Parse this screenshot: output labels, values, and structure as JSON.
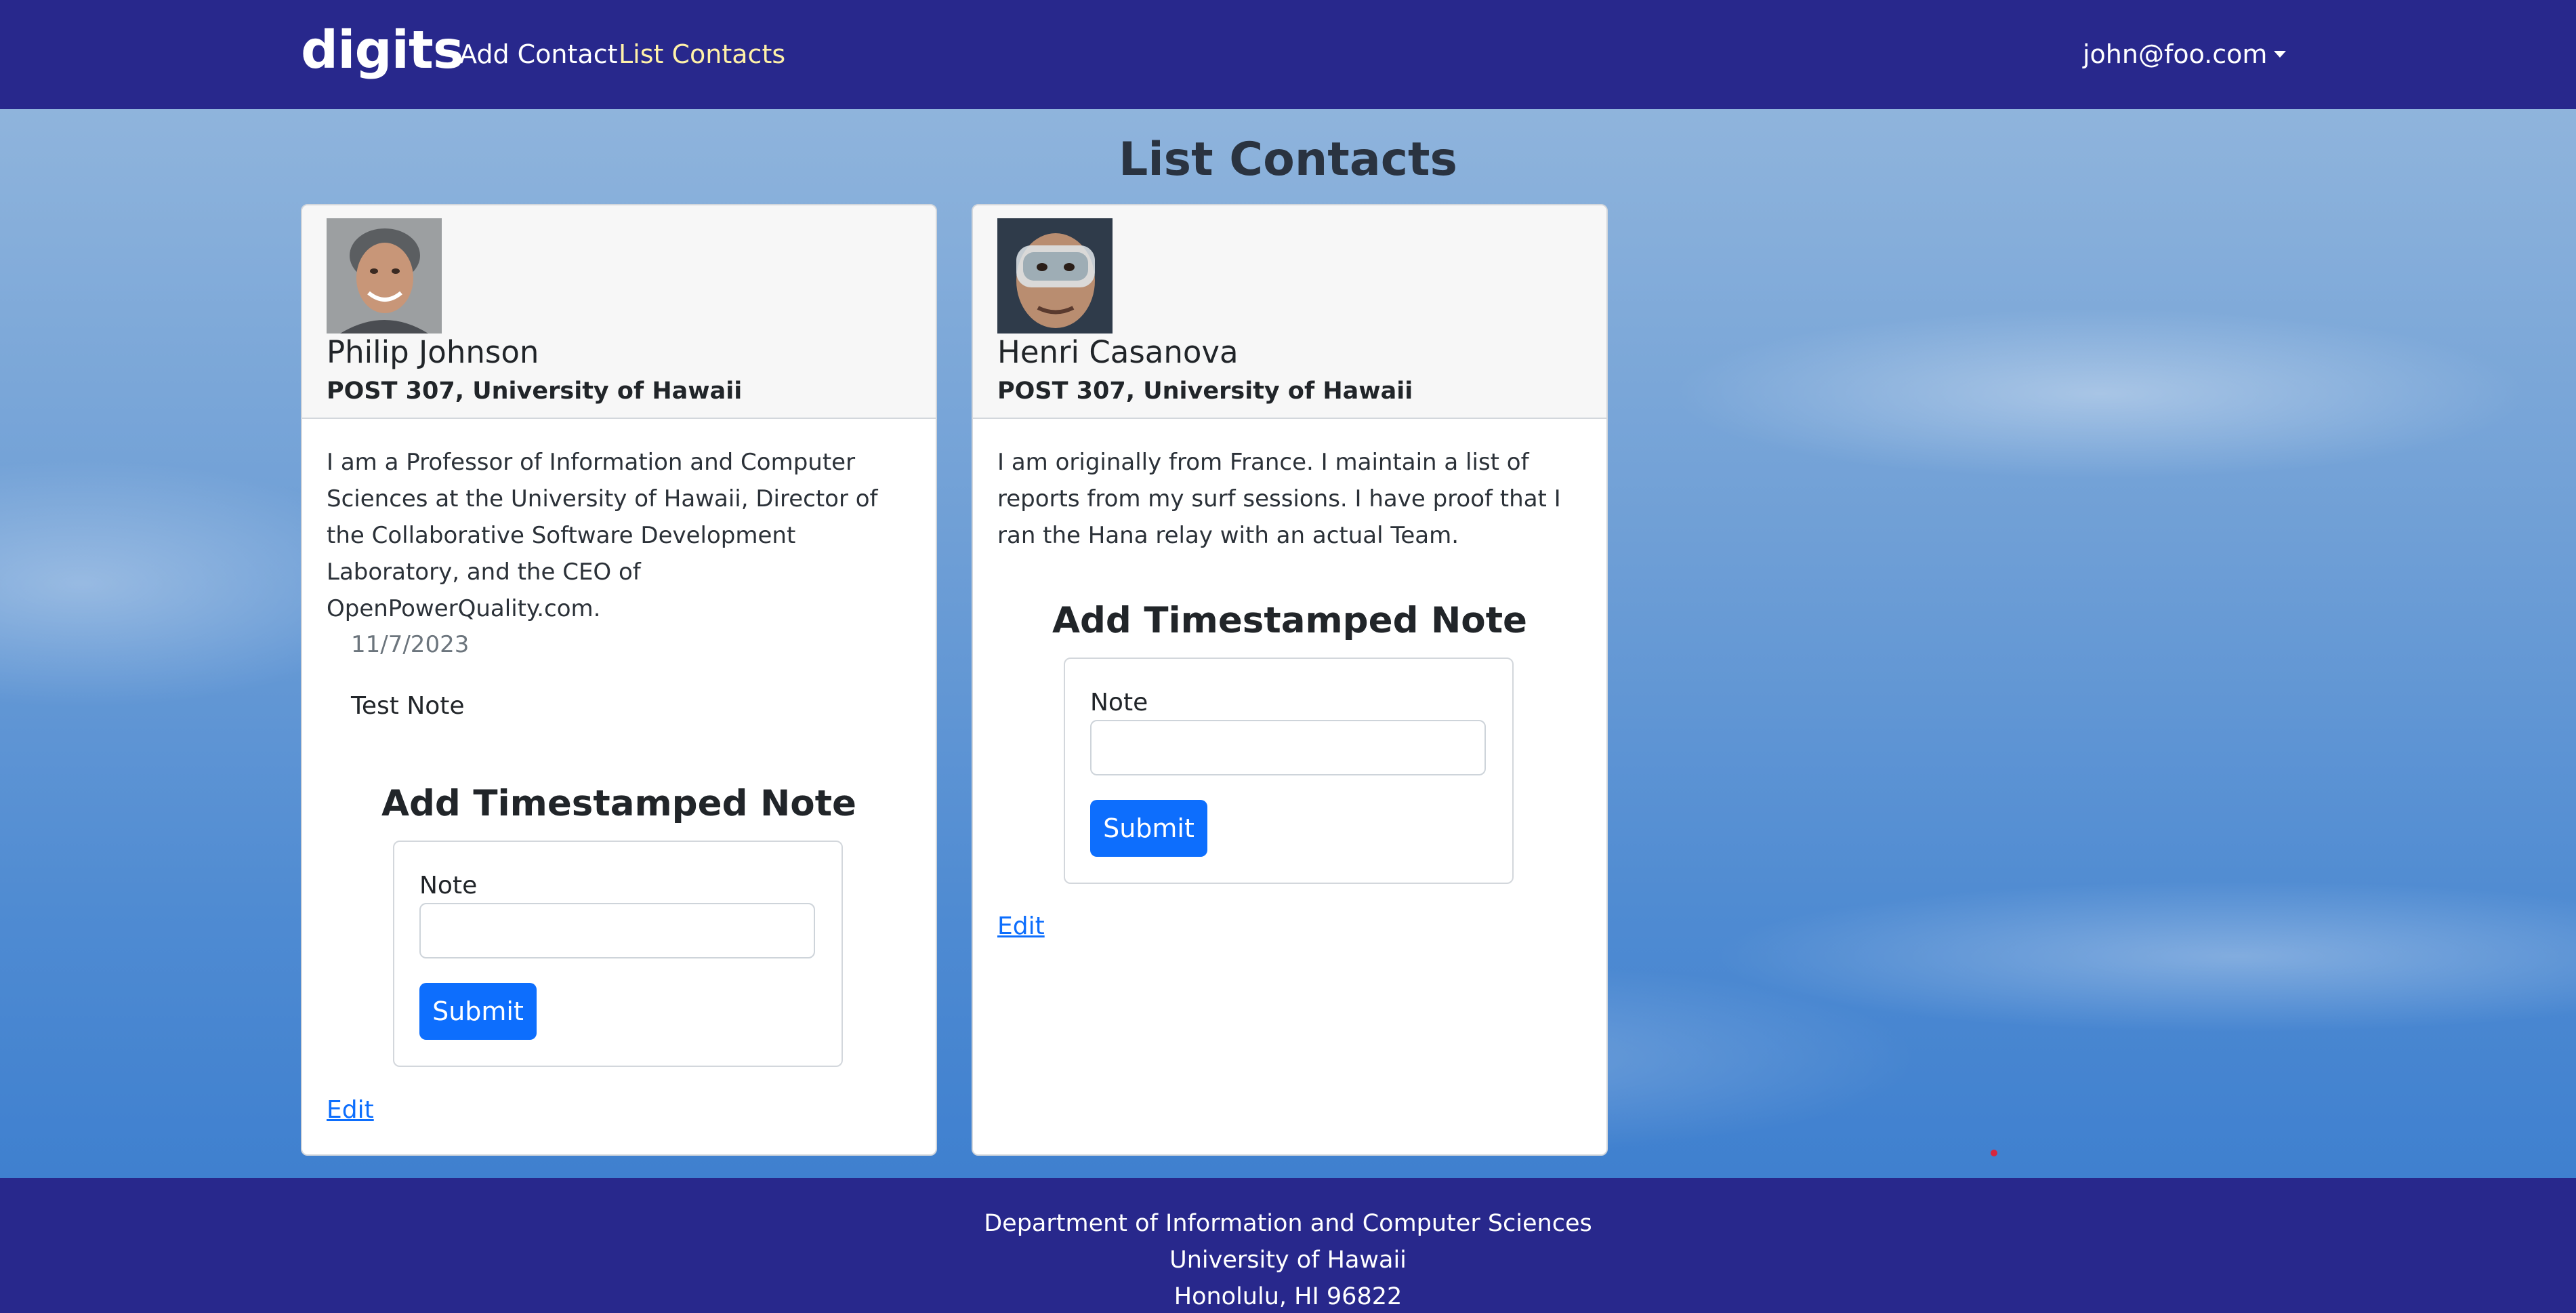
{
  "navbar": {
    "brand": "digits",
    "links": [
      {
        "label": "Add Contact"
      },
      {
        "label": "List Contacts"
      }
    ],
    "user": "john@foo.com"
  },
  "page": {
    "title": "List Contacts"
  },
  "contacts": [
    {
      "name": "Philip Johnson",
      "address": "POST 307, University of Hawaii",
      "description": "I am a Professor of Information and Computer Sciences at the University of Hawaii, Director of the Collaborative Software Development Laboratory, and the CEO of OpenPowerQuality.com.",
      "notes": [
        {
          "date": "11/7/2023",
          "text": "Test Note"
        }
      ],
      "add_note_title": "Add Timestamped Note",
      "note_label": "Note",
      "note_value": "",
      "submit_label": "Submit",
      "edit_label": "Edit"
    },
    {
      "name": "Henri Casanova",
      "address": "POST 307, University of Hawaii",
      "description": "I am originally from France. I maintain a list of reports from my surf sessions. I have proof that I ran the Hana relay with an actual Team.",
      "notes": [],
      "add_note_title": "Add Timestamped Note",
      "note_label": "Note",
      "note_value": "",
      "submit_label": "Submit",
      "edit_label": "Edit"
    }
  ],
  "footer": {
    "lines": [
      "Department of Information and Computer Sciences",
      "University of Hawaii",
      "Honolulu, HI 96822"
    ]
  },
  "colors": {
    "navbar_bg": "#28288c",
    "active_link": "#fff1a8",
    "primary_button": "#0d6efd"
  }
}
